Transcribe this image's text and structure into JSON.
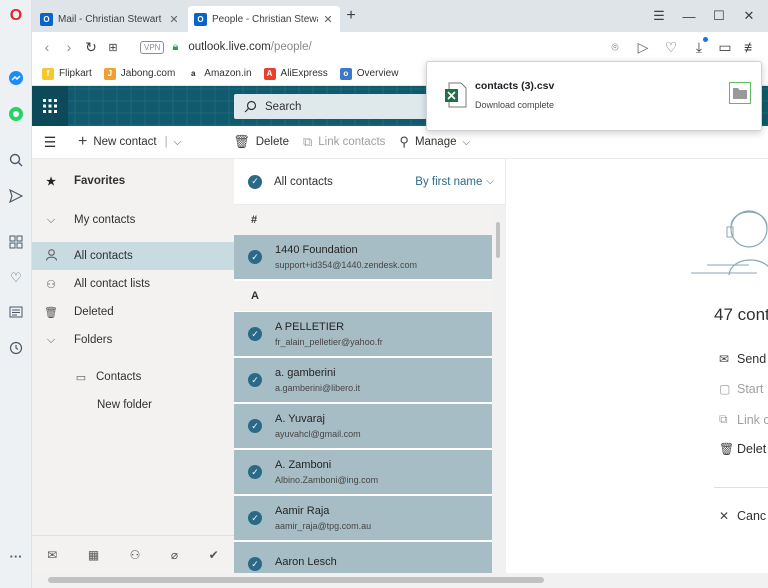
{
  "browser": {
    "tabs": [
      {
        "title": "Mail - Christian Stewart - O",
        "favicon": "O"
      },
      {
        "title": "People - Christian Stewart - ",
        "favicon": "O"
      }
    ],
    "new_tab": "+",
    "url_host": "outlook.live.com",
    "url_path": "/people/",
    "vpn_badge": "VPN",
    "bookmarks": [
      {
        "label": "Flipkart",
        "icon_color": "#f7c82b",
        "glyph": "f"
      },
      {
        "label": "Jabong.com",
        "icon_color": "#f0a030",
        "glyph": "J"
      },
      {
        "label": "Amazon.in",
        "icon_color": "#ffffff",
        "glyph": "a"
      },
      {
        "label": "AliExpress",
        "icon_color": "#e8402a",
        "glyph": "A"
      },
      {
        "label": "Overview",
        "icon_color": "#3c78c8",
        "glyph": "o"
      }
    ]
  },
  "outlook": {
    "search_placeholder": "Search",
    "commands": {
      "new_contact": "New contact",
      "delete": "Delete",
      "link_contacts": "Link contacts",
      "manage": "Manage"
    },
    "nav": {
      "favorites": "Favorites",
      "my_contacts": "My contacts",
      "all_contacts": "All contacts",
      "all_contact_lists": "All contact lists",
      "deleted": "Deleted",
      "folders": "Folders",
      "contacts": "Contacts",
      "new_folder": "New folder"
    },
    "list": {
      "header": "All contacts",
      "sort": "By first name",
      "groups": [
        "#",
        "A"
      ],
      "contacts": [
        {
          "name": "1440 Foundation",
          "email": "support+id354@1440.zendesk.com"
        },
        {
          "name": "A PELLETIER",
          "email": "fr_alain_pelletier@yahoo.fr"
        },
        {
          "name": "a. gamberini",
          "email": "a.gamberini@libero.it"
        },
        {
          "name": "A. Yuvaraj",
          "email": "ayuvahcl@gmail.com"
        },
        {
          "name": "A. Zamboni",
          "email": "Albino.Zamboni@ing.com"
        },
        {
          "name": "Aamir Raja",
          "email": "aamir_raja@tpg.com.au"
        },
        {
          "name": "Aaron Lesch",
          "email": ""
        }
      ]
    },
    "panel": {
      "count_text": "47 cont",
      "actions": [
        "Send",
        "Start",
        "Link c",
        "Delet",
        "Canc"
      ]
    }
  },
  "download": {
    "file_name": "contacts (3).csv",
    "status": "Download complete"
  },
  "colors": {
    "header_bg": "#0f5a6d",
    "selected_row": "#a6bdc6",
    "nav_selected": "#c7dbe1"
  }
}
